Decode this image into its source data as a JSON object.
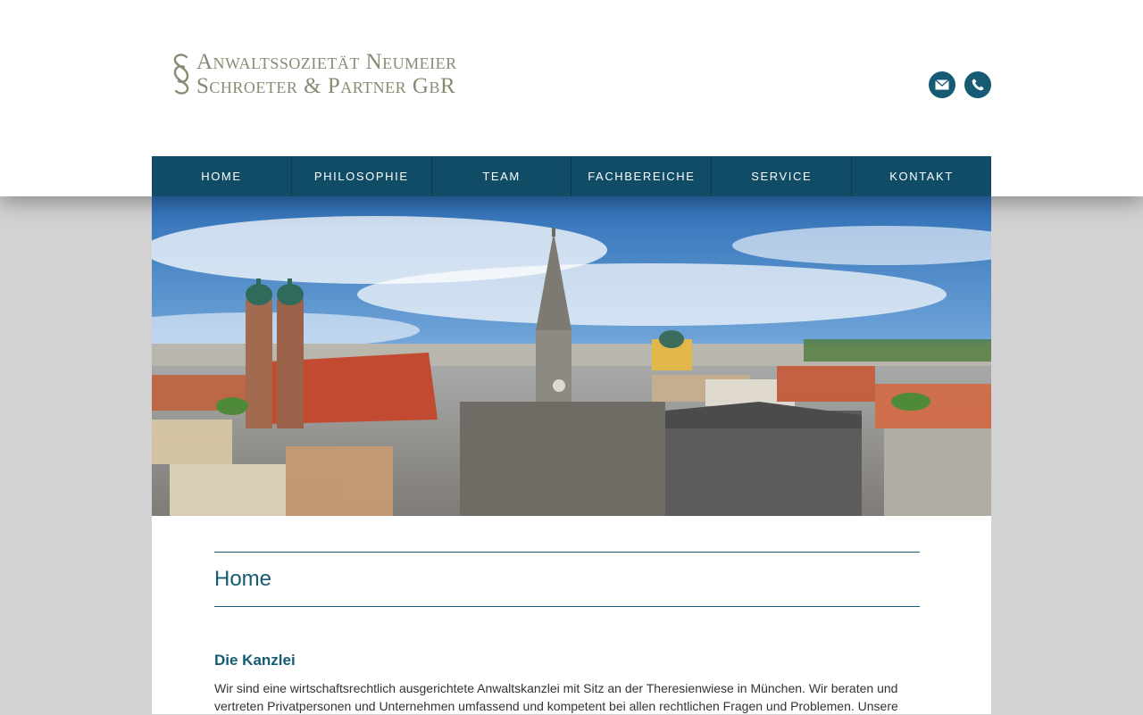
{
  "brand": {
    "line1": "Anwaltssozietät Neumeier",
    "line2": "Schroeter & Partner GbR",
    "logo_icon": "section-sign-logo",
    "color": "#8a8a74"
  },
  "contact_icons": {
    "mail": "mail-icon",
    "phone": "phone-icon",
    "color": "#165a73"
  },
  "nav": {
    "items": [
      {
        "label": "HOME"
      },
      {
        "label": "PHILOSOPHIE"
      },
      {
        "label": "TEAM"
      },
      {
        "label": "FACHBEREICHE"
      },
      {
        "label": "SERVICE"
      },
      {
        "label": "KONTAKT"
      }
    ],
    "background": "#104c66"
  },
  "hero": {
    "subject": "Munich skyline panorama with Frauenkirche and Neues Rathaus"
  },
  "main": {
    "title": "Home",
    "section_title": "Die Kanzlei",
    "paragraph": "Wir sind eine wirtschaftsrechtlich ausgerichtete Anwaltskanzlei mit Sitz an der Theresienwiese in München. Wir beraten und vertreten Privatpersonen und Unternehmen umfassend und kompetent bei allen rechtlichen Fragen und Problemen. Unsere"
  }
}
